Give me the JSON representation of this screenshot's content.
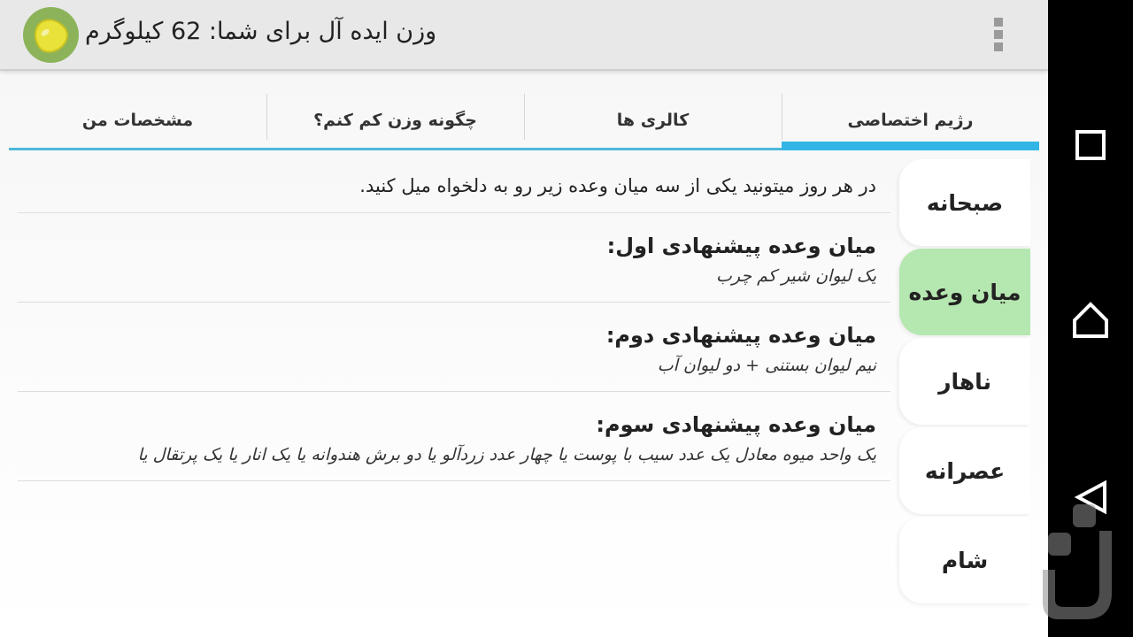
{
  "app_bar": {
    "title": "وزن ایده آل برای شما: 62 کیلوگرم",
    "app_icon": "lemon-icon",
    "overflow_icon": "overflow-menu-icon"
  },
  "tabs": [
    {
      "label": "رژیم اختصاصی",
      "active": true
    },
    {
      "label": "کالری ها",
      "active": false
    },
    {
      "label": "چگونه وزن کم کنم؟",
      "active": false
    },
    {
      "label": "مشخصات من",
      "active": false
    }
  ],
  "meals": [
    {
      "label": "صبحانه",
      "active": false
    },
    {
      "label": "میان وعده",
      "active": true
    },
    {
      "label": "ناهار",
      "active": false
    },
    {
      "label": "عصرانه",
      "active": false
    },
    {
      "label": "شام",
      "active": false
    }
  ],
  "content": {
    "intro": "در هر روز میتونید یکی از سه میان وعده زیر رو به دلخواه میل کنید.",
    "items": [
      {
        "title": "میان وعده پیشنهادی اول:",
        "desc": "یک لیوان شیر کم چرب"
      },
      {
        "title": "میان وعده پیشنهادی دوم:",
        "desc": "نیم لیوان بستنی + دو لیوان آب"
      },
      {
        "title": "میان وعده پیشنهادی سوم:",
        "desc": "یک واحد میوه معادل یک عدد سیب با پوست یا چهار عدد زردآلو یا دو برش هندوانه یا یک انار یا یک پرتقال یا"
      }
    ]
  },
  "colors": {
    "tab_indicator": "#33b5e5",
    "active_meal": "#b5e7b0",
    "app_bar": "#e8e8e8"
  },
  "nav": {
    "recents_icon": "recents-square-icon",
    "home_icon": "home-icon",
    "back_icon": "back-triangle-icon"
  }
}
